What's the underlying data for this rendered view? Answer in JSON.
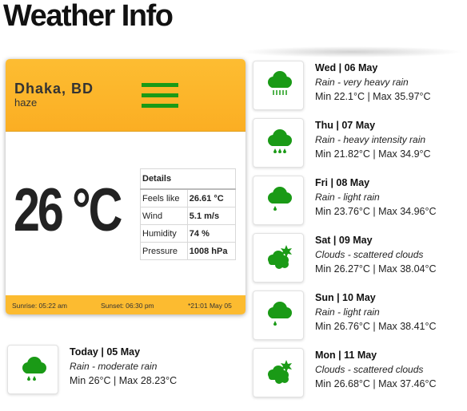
{
  "page": {
    "title": "Weather Info"
  },
  "current": {
    "location": "Dhaka, BD",
    "description": "haze",
    "temperature": "26 °C",
    "details_heading": "Details",
    "details": [
      {
        "label": "Feels like",
        "value": "26.61 °C"
      },
      {
        "label": "Wind",
        "value": "5.1 m/s"
      },
      {
        "label": "Humidity",
        "value": "74 %"
      },
      {
        "label": "Pressure",
        "value": "1008 hPa"
      }
    ],
    "sunrise": "Sunrise: 05:22 am",
    "sunset": "Sunset: 06:30 pm",
    "updated": "*21:01 May 05",
    "header_color": "#fcb62b",
    "menu_icon_color": "#1a9a16"
  },
  "today": {
    "day": "Today | 05 May",
    "condition": "Rain - moderate rain",
    "minmax": "Min 26°C | Max 28.23°C",
    "icon": "rain-cloud-icon"
  },
  "forecast": [
    {
      "day": "Wed | 06 May",
      "condition": "Rain - very heavy rain",
      "minmax": "Min 22.1°C | Max 35.97°C",
      "icon": "heavy-rain-cloud-icon"
    },
    {
      "day": "Thu | 07 May",
      "condition": "Rain - heavy intensity rain",
      "minmax": "Min 21.82°C | Max 34.9°C",
      "icon": "rain-cloud-icon"
    },
    {
      "day": "Fri | 08 May",
      "condition": "Rain - light rain",
      "minmax": "Min 23.76°C | Max 34.96°C",
      "icon": "light-rain-cloud-icon"
    },
    {
      "day": "Sat | 09 May",
      "condition": "Clouds - scattered clouds",
      "minmax": "Min 26.27°C | Max 38.04°C",
      "icon": "scattered-clouds-icon"
    },
    {
      "day": "Sun | 10 May",
      "condition": "Rain - light rain",
      "minmax": "Min 26.76°C | Max 38.41°C",
      "icon": "light-rain-cloud-icon"
    },
    {
      "day": "Mon | 11 May",
      "condition": "Clouds - scattered clouds",
      "minmax": "Min 26.68°C | Max 37.46°C",
      "icon": "scattered-clouds-icon"
    }
  ],
  "icon_color": "#1a9a16"
}
